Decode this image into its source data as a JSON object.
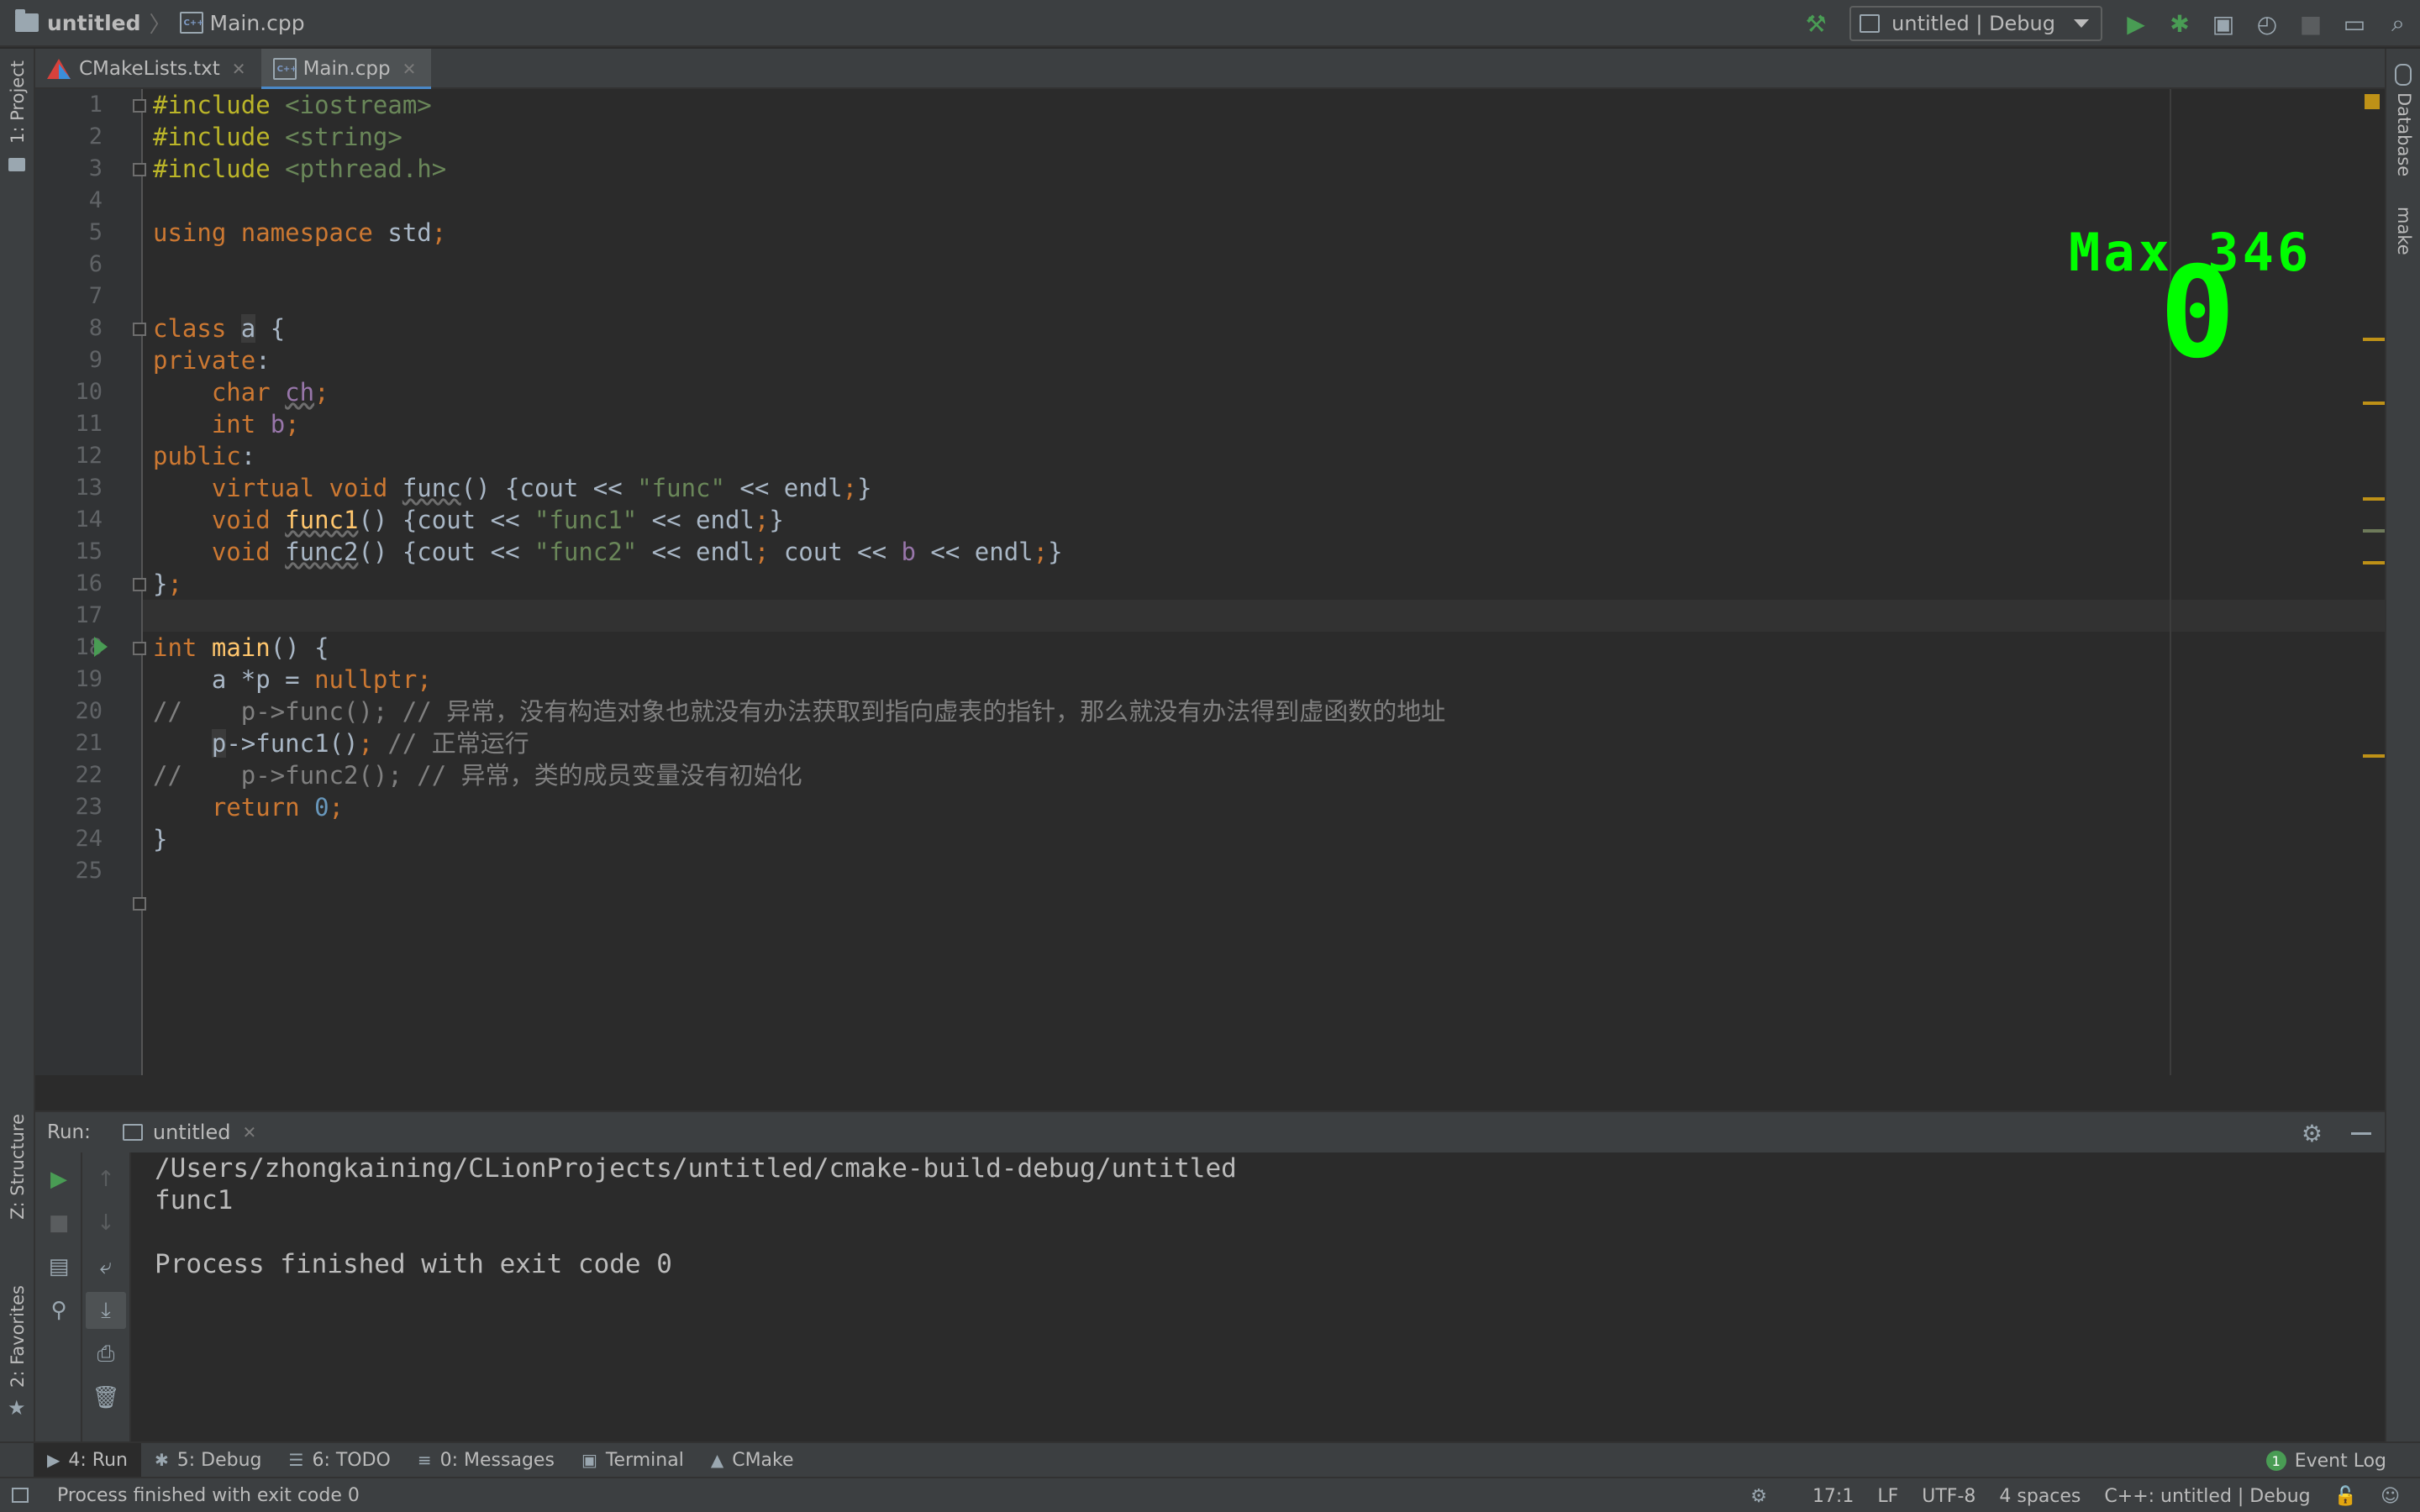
{
  "navbar": {
    "project": "untitled",
    "file": "Main.cpp",
    "run_config": "untitled | Debug"
  },
  "left_strip": {
    "project_tab": "1: Project",
    "structure_tab": "Z: Structure",
    "favorites_tab": "2: Favorites"
  },
  "right_strip": {
    "database_tab": "Database",
    "make_tab": "make"
  },
  "tabs": [
    {
      "label": "CMakeLists.txt",
      "icon": "cmake-icon",
      "active": false
    },
    {
      "label": "Main.cpp",
      "icon": "cpp-file-icon",
      "active": true
    }
  ],
  "editor": {
    "line_numbers": [
      "1",
      "2",
      "3",
      "4",
      "5",
      "6",
      "7",
      "8",
      "9",
      "10",
      "11",
      "12",
      "13",
      "14",
      "15",
      "16",
      "17",
      "18",
      "19",
      "20",
      "21",
      "22",
      "23",
      "24",
      "25"
    ],
    "overlay": {
      "max_label": "Max 346",
      "value": "0"
    },
    "code": {
      "l1a": "#include",
      "l1b": " <iostream>",
      "l2a": "#include",
      "l2b": " <string>",
      "l3a": "#include",
      "l3b": " <pthread.h>",
      "l5a": "using namespace",
      "l5b": " std",
      "l5c": ";",
      "l8a": "class",
      "l8b": " ",
      "l8c": "a",
      "l8d": " {",
      "l9a": "private",
      "l9b": ":",
      "l10a": "    char",
      "l10b": " ",
      "l10c": "ch",
      "l10d": ";",
      "l11a": "    int",
      "l11b": " ",
      "l11c": "b",
      "l11d": ";",
      "l12a": "public",
      "l12b": ":",
      "l13a": "    virtual void",
      "l13b": " ",
      "l13c": "func",
      "l13d": "() {cout << ",
      "l13e": "\"func\"",
      "l13f": " << endl",
      "l13g": ";",
      "l13h": "}",
      "l14a": "    void",
      "l14b": " ",
      "l14c": "func1",
      "l14d": "() {cout << ",
      "l14e": "\"func1\"",
      "l14f": " << endl",
      "l14g": ";",
      "l14h": "}",
      "l15a": "    void",
      "l15b": " ",
      "l15c": "func2",
      "l15d": "() {cout << ",
      "l15e": "\"func2\"",
      "l15f": " << endl",
      "l15g": ";",
      "l15h": " cout << ",
      "l15i": "b",
      "l15j": " << endl",
      "l15k": ";",
      "l15l": "}",
      "l16a": "}",
      "l16b": ";",
      "l18a": "int",
      "l18b": " ",
      "l18c": "main",
      "l18d": "() {",
      "l19a": "    a *p = ",
      "l19b": "nullptr",
      "l19c": ";",
      "l20": "//    p->func(); // 异常，没有构造对象也就没有办法获取到指向虚表的指针，那么就没有办法得到虚函数的地址",
      "l21a": "    ",
      "l21b": "p",
      "l21c": "->func1()",
      "l21d": ";",
      "l21e": " // 正常运行",
      "l22": "//    p->func2(); // 异常，类的成员变量没有初始化",
      "l23a": "    return",
      "l23b": " ",
      "l23c": "0",
      "l23d": ";",
      "l24": "}"
    }
  },
  "run": {
    "label": "Run:",
    "tab": "untitled",
    "console": [
      "/Users/zhongkaining/CLionProjects/untitled/cmake-build-debug/untitled",
      "func1",
      "",
      "Process finished with exit code 0"
    ]
  },
  "bottom_tools": [
    {
      "label": "4: Run",
      "icon": "play-icon",
      "active": true
    },
    {
      "label": "5: Debug",
      "icon": "bug-icon",
      "active": false
    },
    {
      "label": "6: TODO",
      "icon": "list-icon",
      "active": false
    },
    {
      "label": "0: Messages",
      "icon": "messages-icon",
      "active": false
    },
    {
      "label": "Terminal",
      "icon": "terminal-icon",
      "active": false
    },
    {
      "label": "CMake",
      "icon": "cmake-icon",
      "active": false
    }
  ],
  "event_log": {
    "count": "1",
    "label": "Event Log"
  },
  "statusbar": {
    "message": "Process finished with exit code 0",
    "position": "17:1",
    "line_sep": "LF",
    "encoding": "UTF-8",
    "indent": "4 spaces",
    "context": "C++: untitled | Debug"
  },
  "colors": {
    "background": "#2b2b2b",
    "panel": "#3c3f41",
    "keyword": "#cc7832",
    "string": "#6a8759",
    "overlay": "#00ff00",
    "run_green": "#499c54"
  }
}
